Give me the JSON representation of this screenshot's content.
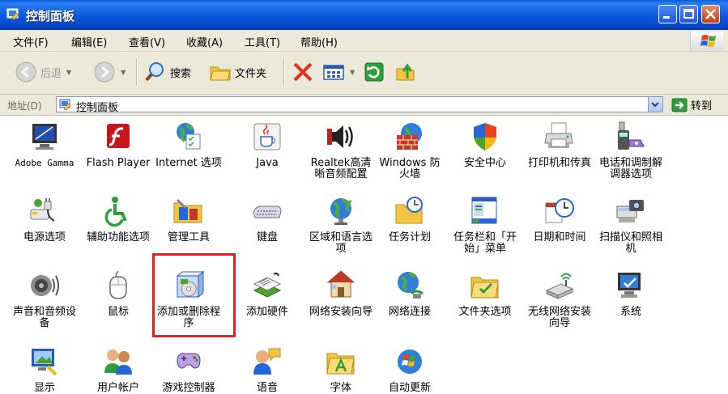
{
  "window": {
    "title": "控制面板",
    "colors": {
      "titlebar": "#0a5fe0",
      "close": "#c53c1a",
      "highlight": "#e02020"
    }
  },
  "menu": [
    "文件(F)",
    "编辑(E)",
    "查看(V)",
    "收藏(A)",
    "工具(T)",
    "帮助(H)"
  ],
  "toolbar": {
    "back": "后退",
    "search": "搜索",
    "folders": "文件夹"
  },
  "address": {
    "label": "地址(D)",
    "value": "控制面板",
    "go": "转到"
  },
  "items": [
    {
      "label": "Adobe Gamma",
      "icon": "monitor-gamma-icon"
    },
    {
      "label": "Flash Player",
      "icon": "flash-icon"
    },
    {
      "label": "Internet 选项",
      "icon": "globe-options-icon"
    },
    {
      "label": "Java",
      "icon": "java-cup-icon"
    },
    {
      "label": "Realtek高清晰音频配置",
      "icon": "speaker-icon"
    },
    {
      "label": "Windows 防火墙",
      "icon": "firewall-icon"
    },
    {
      "label": "安全中心",
      "icon": "shield-icon"
    },
    {
      "label": "打印机和传真",
      "icon": "printer-icon"
    },
    {
      "label": "电话和调制解调器选项",
      "icon": "phone-icon"
    },
    {
      "label": "电源选项",
      "icon": "power-plug-icon"
    },
    {
      "label": "辅助功能选项",
      "icon": "accessibility-icon"
    },
    {
      "label": "管理工具",
      "icon": "admin-tools-icon"
    },
    {
      "label": "键盘",
      "icon": "keyboard-icon"
    },
    {
      "label": "区域和语言选项",
      "icon": "globe-icon"
    },
    {
      "label": "任务计划",
      "icon": "scheduled-tasks-icon"
    },
    {
      "label": "任务栏和「开始」菜单",
      "icon": "taskbar-icon"
    },
    {
      "label": "日期和时间",
      "icon": "clock-icon"
    },
    {
      "label": "扫描仪和照相机",
      "icon": "scanner-camera-icon"
    },
    {
      "label": "声音和音频设备",
      "icon": "sound-icon"
    },
    {
      "label": "鼠标",
      "icon": "mouse-icon"
    },
    {
      "label": "添加或删除程序",
      "icon": "add-remove-programs-icon"
    },
    {
      "label": "添加硬件",
      "icon": "add-hardware-icon"
    },
    {
      "label": "网络安装向导",
      "icon": "network-setup-icon"
    },
    {
      "label": "网络连接",
      "icon": "network-connections-icon"
    },
    {
      "label": "文件夹选项",
      "icon": "folder-options-icon"
    },
    {
      "label": "无线网络安装向导",
      "icon": "wireless-icon"
    },
    {
      "label": "系统",
      "icon": "system-icon"
    },
    {
      "label": "显示",
      "icon": "display-icon"
    },
    {
      "label": "用户帐户",
      "icon": "user-accounts-icon"
    },
    {
      "label": "游戏控制器",
      "icon": "game-controller-icon"
    },
    {
      "label": "语音",
      "icon": "speech-icon"
    },
    {
      "label": "字体",
      "icon": "fonts-icon"
    },
    {
      "label": "自动更新",
      "icon": "windows-update-icon"
    }
  ]
}
